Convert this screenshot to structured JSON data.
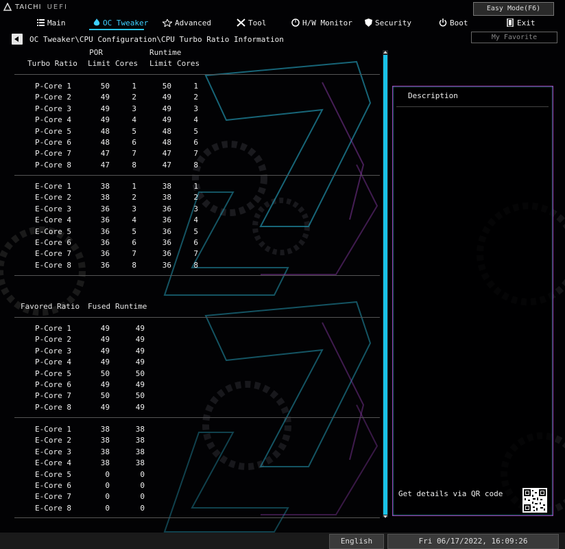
{
  "header": {
    "brand": "TAICHI",
    "brand_suffix": "UEFI",
    "easy_mode": "Easy Mode(F6)",
    "my_favorite": "My Favorite"
  },
  "nav": [
    {
      "label": "Main",
      "icon": "list-icon",
      "active": false
    },
    {
      "label": "OC Tweaker",
      "icon": "flame-icon",
      "active": true
    },
    {
      "label": "Advanced",
      "icon": "star-icon",
      "active": false
    },
    {
      "label": "Tool",
      "icon": "tools-icon",
      "active": false
    },
    {
      "label": "H/W Monitor",
      "icon": "monitor-icon",
      "active": false
    },
    {
      "label": "Security",
      "icon": "shield-icon",
      "active": false
    },
    {
      "label": "Boot",
      "icon": "power-icon",
      "active": false
    },
    {
      "label": "Exit",
      "icon": "exit-icon",
      "active": false
    }
  ],
  "breadcrumb": "OC Tweaker\\CPU Configuration\\CPU Turbo Ratio Information",
  "turbo_table": {
    "header_label": "Turbo Ratio",
    "group1": "POR",
    "group2": "Runtime",
    "col_limit": "Limit",
    "col_cores": "Cores",
    "pcores": [
      {
        "name": "P-Core 1",
        "por_limit": "50",
        "por_cores": "1",
        "rt_limit": "50",
        "rt_cores": "1"
      },
      {
        "name": "P-Core 2",
        "por_limit": "49",
        "por_cores": "2",
        "rt_limit": "49",
        "rt_cores": "2"
      },
      {
        "name": "P-Core 3",
        "por_limit": "49",
        "por_cores": "3",
        "rt_limit": "49",
        "rt_cores": "3"
      },
      {
        "name": "P-Core 4",
        "por_limit": "49",
        "por_cores": "4",
        "rt_limit": "49",
        "rt_cores": "4"
      },
      {
        "name": "P-Core 5",
        "por_limit": "48",
        "por_cores": "5",
        "rt_limit": "48",
        "rt_cores": "5"
      },
      {
        "name": "P-Core 6",
        "por_limit": "48",
        "por_cores": "6",
        "rt_limit": "48",
        "rt_cores": "6"
      },
      {
        "name": "P-Core 7",
        "por_limit": "47",
        "por_cores": "7",
        "rt_limit": "47",
        "rt_cores": "7"
      },
      {
        "name": "P-Core 8",
        "por_limit": "47",
        "por_cores": "8",
        "rt_limit": "47",
        "rt_cores": "8"
      }
    ],
    "ecores": [
      {
        "name": "E-Core 1",
        "por_limit": "38",
        "por_cores": "1",
        "rt_limit": "38",
        "rt_cores": "1"
      },
      {
        "name": "E-Core 2",
        "por_limit": "38",
        "por_cores": "2",
        "rt_limit": "38",
        "rt_cores": "2"
      },
      {
        "name": "E-Core 3",
        "por_limit": "36",
        "por_cores": "3",
        "rt_limit": "36",
        "rt_cores": "3"
      },
      {
        "name": "E-Core 4",
        "por_limit": "36",
        "por_cores": "4",
        "rt_limit": "36",
        "rt_cores": "4"
      },
      {
        "name": "E-Core 5",
        "por_limit": "36",
        "por_cores": "5",
        "rt_limit": "36",
        "rt_cores": "5"
      },
      {
        "name": "E-Core 6",
        "por_limit": "36",
        "por_cores": "6",
        "rt_limit": "36",
        "rt_cores": "6"
      },
      {
        "name": "E-Core 7",
        "por_limit": "36",
        "por_cores": "7",
        "rt_limit": "36",
        "rt_cores": "7"
      },
      {
        "name": "E-Core 8",
        "por_limit": "36",
        "por_cores": "8",
        "rt_limit": "36",
        "rt_cores": "8"
      }
    ]
  },
  "favored_table": {
    "header_label": "Favored Ratio",
    "col_fused": "Fused",
    "col_runtime": "Runtime",
    "pcores": [
      {
        "name": "P-Core 1",
        "fused": "49",
        "runtime": "49"
      },
      {
        "name": "P-Core 2",
        "fused": "49",
        "runtime": "49"
      },
      {
        "name": "P-Core 3",
        "fused": "49",
        "runtime": "49"
      },
      {
        "name": "P-Core 4",
        "fused": "49",
        "runtime": "49"
      },
      {
        "name": "P-Core 5",
        "fused": "50",
        "runtime": "50"
      },
      {
        "name": "P-Core 6",
        "fused": "49",
        "runtime": "49"
      },
      {
        "name": "P-Core 7",
        "fused": "50",
        "runtime": "50"
      },
      {
        "name": "P-Core 8",
        "fused": "49",
        "runtime": "49"
      }
    ],
    "ecores": [
      {
        "name": "E-Core 1",
        "fused": "38",
        "runtime": "38"
      },
      {
        "name": "E-Core 2",
        "fused": "38",
        "runtime": "38"
      },
      {
        "name": "E-Core 3",
        "fused": "38",
        "runtime": "38"
      },
      {
        "name": "E-Core 4",
        "fused": "38",
        "runtime": "38"
      },
      {
        "name": "E-Core 5",
        "fused": "0",
        "runtime": "0"
      },
      {
        "name": "E-Core 6",
        "fused": "0",
        "runtime": "0"
      },
      {
        "name": "E-Core 7",
        "fused": "0",
        "runtime": "0"
      },
      {
        "name": "E-Core 8",
        "fused": "0",
        "runtime": "0"
      }
    ]
  },
  "description": {
    "title": "Description",
    "qr_text": "Get details via QR code"
  },
  "footer": {
    "language": "English",
    "datetime": "Fri 06/17/2022, 16:09:26"
  },
  "colors": {
    "accent_cyan": "#19c2e8",
    "accent_magenta": "#a040b0",
    "background": "#000000"
  }
}
